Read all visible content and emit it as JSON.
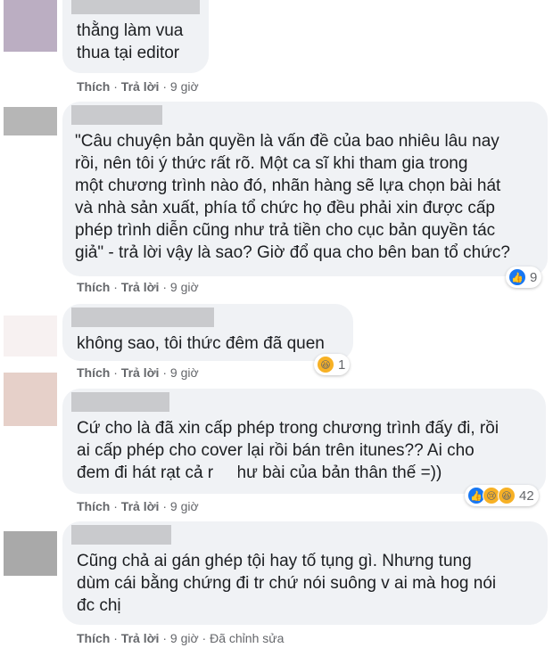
{
  "comments": [
    {
      "avatar_color": "#bbaec2",
      "text": "thằng làm vua\nthua tại editor",
      "actions": {
        "like": "Thích",
        "reply": "Trả lời",
        "time": "9 giờ"
      }
    },
    {
      "avatar_color": "#b6b6b6",
      "text": "\"Câu chuyện bản quyền là vấn đề của bao nhiêu lâu nay\nrồi, nên tôi ý thức rất rõ. Một ca sĩ khi tham gia trong\nmột chương trình nào đó, nhãn hàng sẽ lựa chọn bài hát\nvà nhà sản xuất, phía tổ chức họ đều phải xin được cấp\nphép trình diễn cũng như trả tiền cho cục bản quyền tác\ngiả\" - trả lời vậy là sao? Giờ đổ qua cho bên ban tổ chức?",
      "actions": {
        "like": "Thích",
        "reply": "Trả lời",
        "time": "9 giờ"
      },
      "reactions": {
        "icons": [
          "like-icon"
        ],
        "count": "9"
      }
    },
    {
      "avatar_color": "#f7f1f1",
      "text": "không sao, tôi thức đêm đã quen",
      "actions": {
        "like": "Thích",
        "reply": "Trả lời",
        "time": "9 giờ"
      },
      "reactions": {
        "icons": [
          "haha-icon"
        ],
        "count": "1"
      }
    },
    {
      "avatar_color": "#e6d0c9",
      "text": "Cứ cho là đã xin cấp phép trong chương trình đấy đi, rồi\nai cấp phép cho cover lại rồi bán trên itunes?? Ai cho\nđem đi hát rạt cả    ra như bài của bản thân thế =))",
      "actions": {
        "like": "Thích",
        "reply": "Trả lời",
        "time": "9 giờ"
      },
      "reactions": {
        "icons": [
          "like-icon",
          "sad-icon",
          "haha-icon"
        ],
        "count": "42"
      }
    },
    {
      "avatar_color": "#a9a9a9",
      "text": "Cũng chả ai gán ghép tội hay tố tụng gì. Nhưng tung\ndùm cái bằng chứng đi tr chứ nói suông v ai mà hog nói\nđc chị",
      "actions": {
        "like": "Thích",
        "reply": "Trả lời",
        "time": "9 giờ",
        "edited": "Đã chỉnh sửa"
      }
    }
  ],
  "icon_glyphs": {
    "like-icon": "👍",
    "sad-icon": "😢",
    "haha-icon": "😆"
  }
}
